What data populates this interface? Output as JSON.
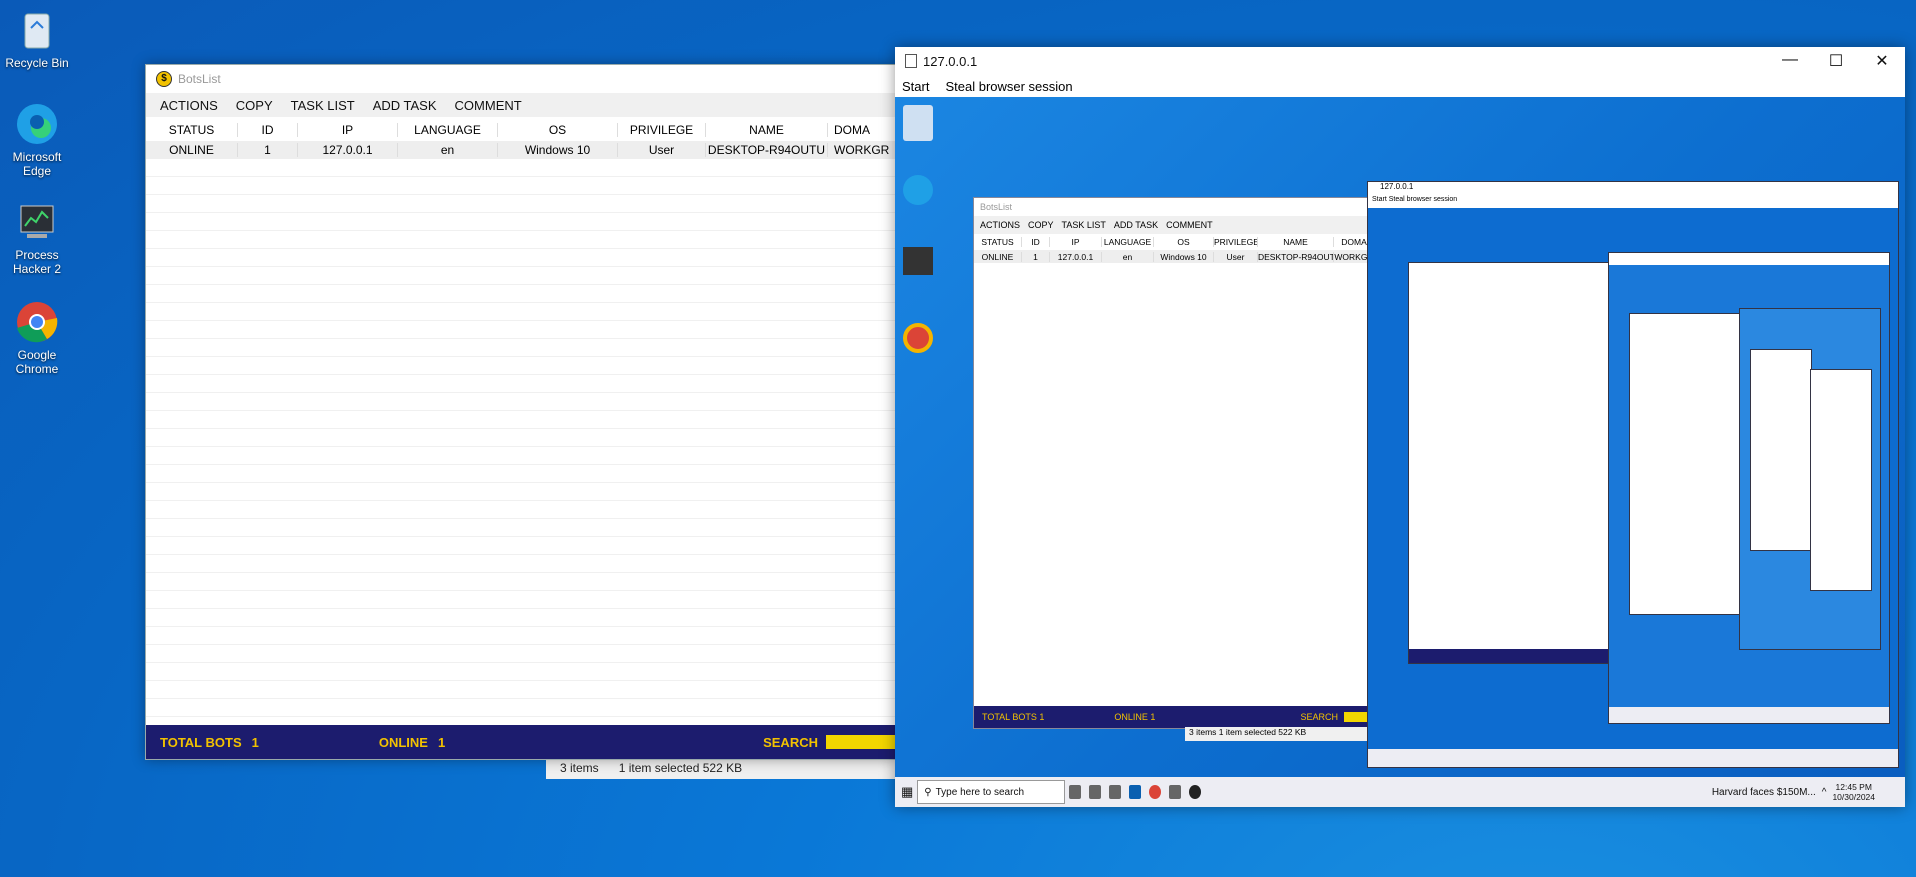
{
  "desktop": {
    "icons": [
      {
        "label": "Recycle Bin",
        "icon": "recycle-bin-icon"
      },
      {
        "label": "Microsoft Edge",
        "icon": "edge-icon"
      },
      {
        "label": "Process Hacker 2",
        "icon": "process-hacker-icon"
      },
      {
        "label": "Google Chrome",
        "icon": "chrome-icon"
      }
    ]
  },
  "botslist": {
    "title": "BotsList",
    "menu": [
      "ACTIONS",
      "COPY",
      "TASK LIST",
      "ADD TASK",
      "COMMENT"
    ],
    "columns": [
      "STATUS",
      "ID",
      "IP",
      "LANGUAGE",
      "OS",
      "PRIVILEGE",
      "NAME",
      "DOMA"
    ],
    "rows": [
      [
        "ONLINE",
        "1",
        "127.0.0.1",
        "en",
        "Windows 10",
        "User",
        "DESKTOP-R94OUTU",
        "WORKGR"
      ]
    ],
    "status": {
      "total_label": "TOTAL BOTS",
      "total_value": "1",
      "online_label": "ONLINE",
      "online_value": "1",
      "search_label": "SEARCH"
    }
  },
  "explorer_status": {
    "items": "3 items",
    "selected": "1 item selected  522 KB"
  },
  "remote": {
    "title": "127.0.0.1",
    "menu": [
      "Start",
      "Steal browser session"
    ],
    "inner": {
      "menu": [
        "ACTIONS",
        "COPY",
        "TASK LIST",
        "ADD TASK",
        "COMMENT"
      ],
      "columns": [
        "STATUS",
        "ID",
        "IP",
        "LANGUAGE",
        "OS",
        "PRIVILEGE",
        "NAME",
        "DOMA"
      ],
      "rows": [
        [
          "ONLINE",
          "1",
          "127.0.0.1",
          "en",
          "Windows 10",
          "User",
          "DESKTOP-R94OUTU",
          "WORKGR"
        ]
      ],
      "status": {
        "total": "TOTAL BOTS   1",
        "online": "ONLINE   1",
        "search": "SEARCH"
      },
      "explorer": "3 items     1 item selected  522 KB"
    },
    "taskbar": {
      "search_placeholder": "Type here to search",
      "news": "Harvard faces $150M...",
      "time": "12:45 PM",
      "date": "10/30/2024"
    }
  },
  "colors": {
    "accent": "#1c1c6e",
    "highlight": "#f2c200",
    "desktop": "#0a78d7"
  }
}
